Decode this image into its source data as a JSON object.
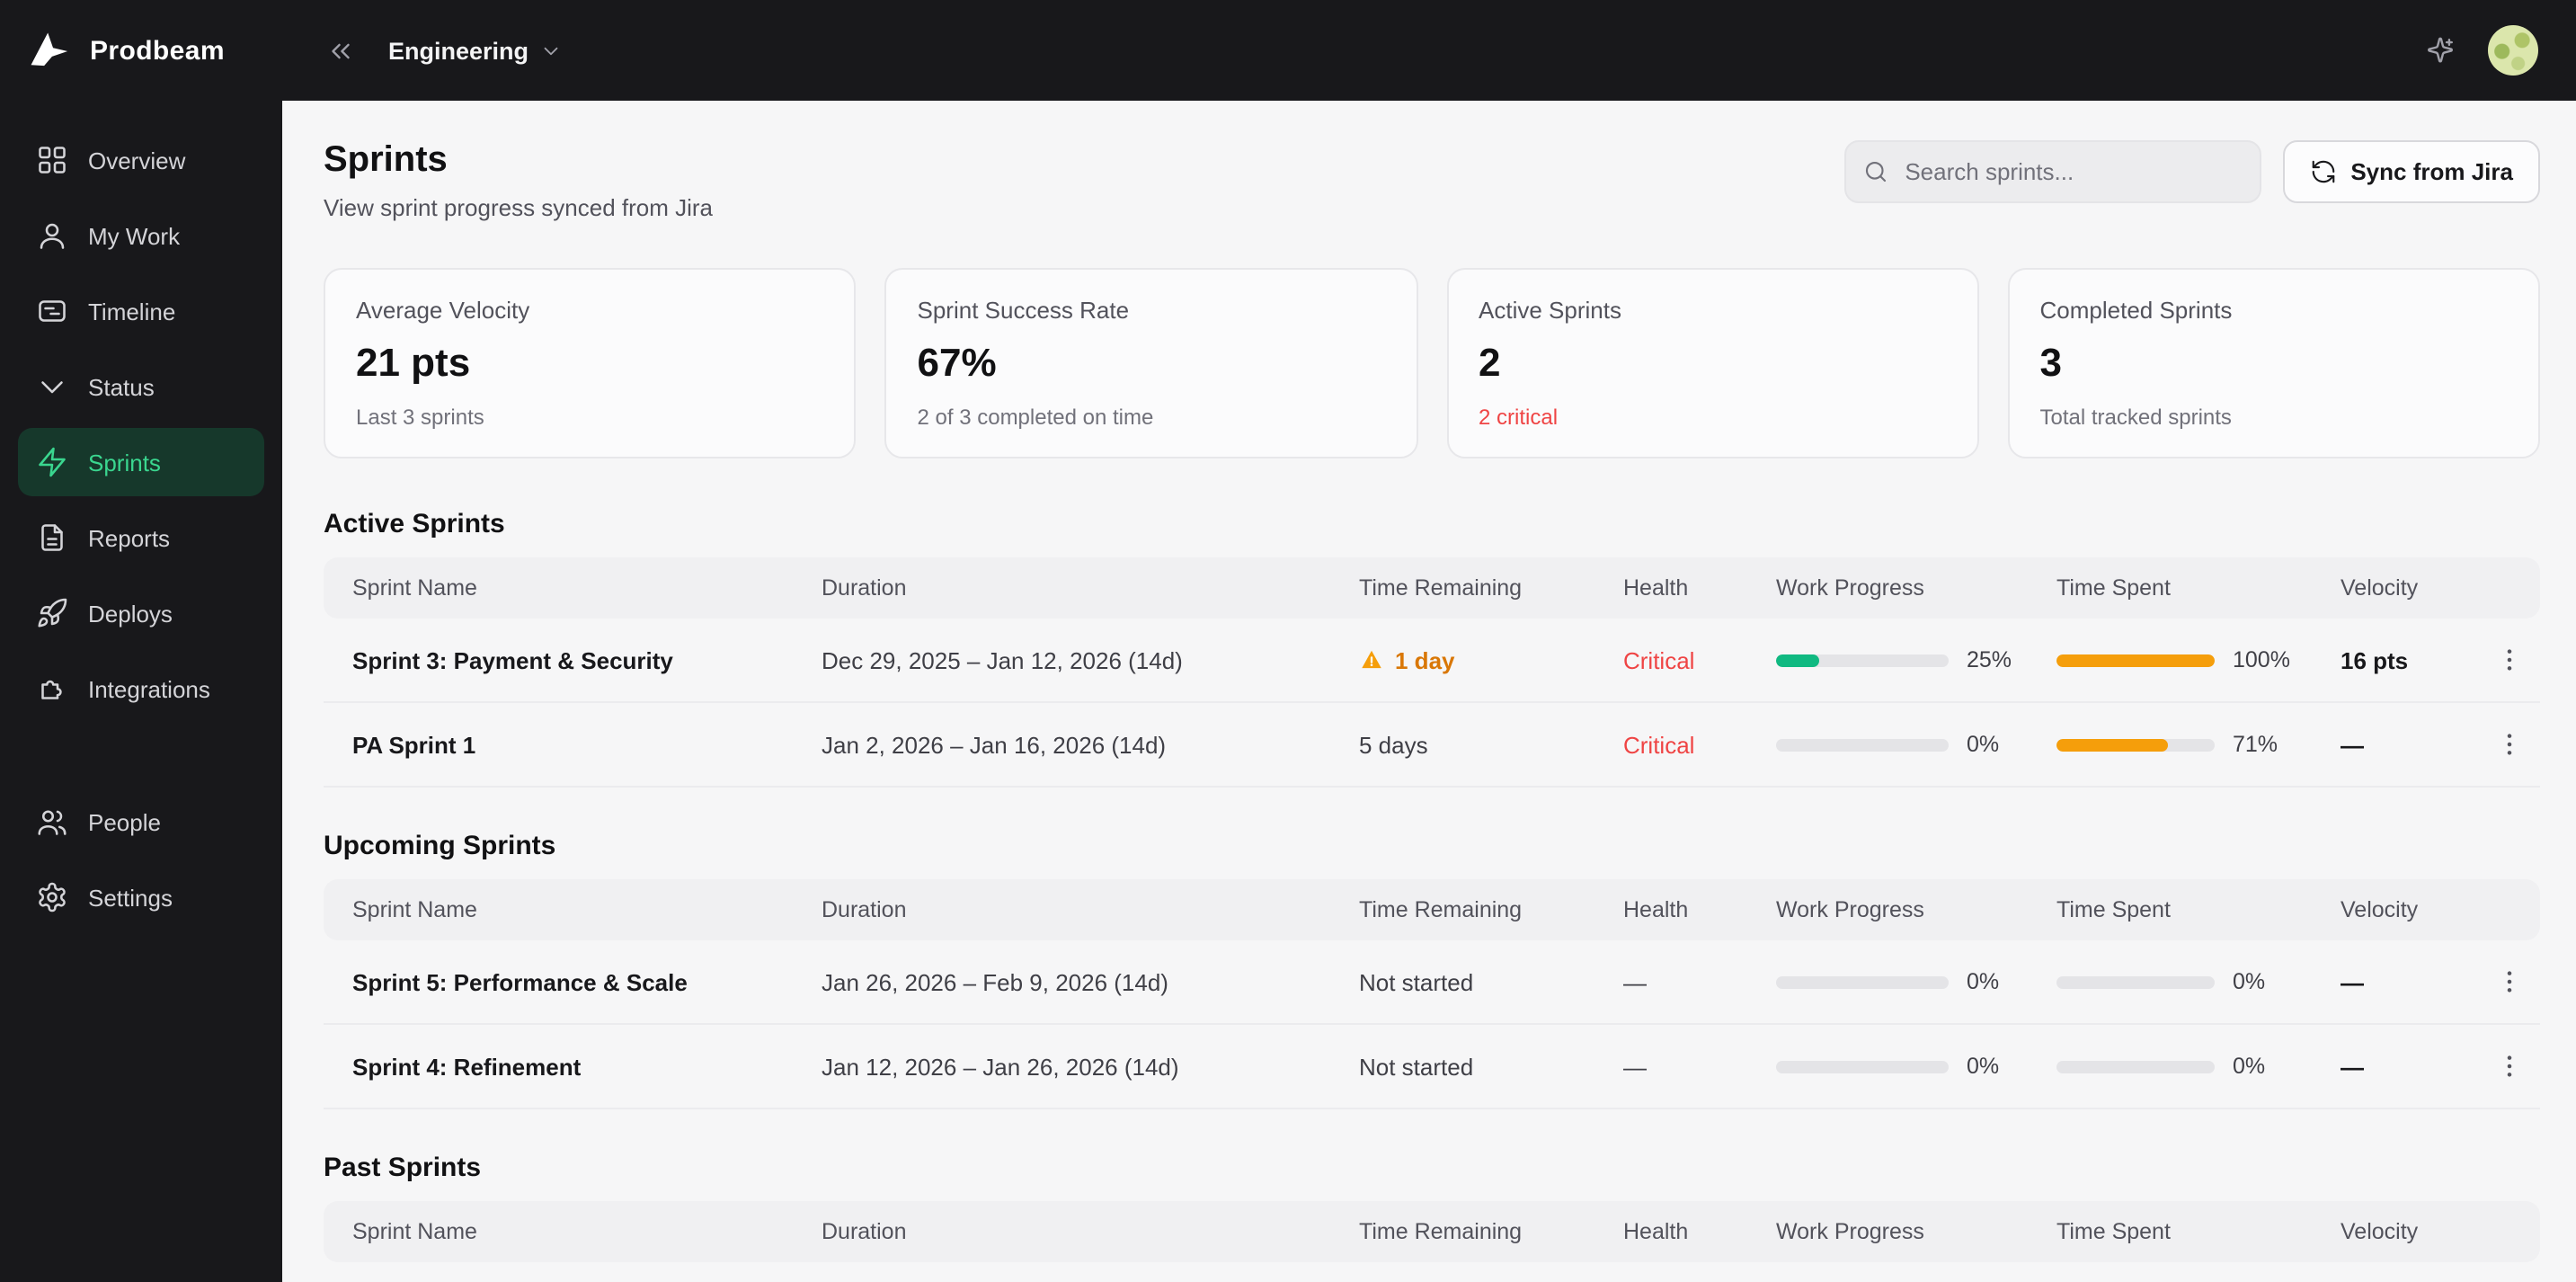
{
  "brand": {
    "name": "Prodbeam"
  },
  "topbar": {
    "workspace": "Engineering"
  },
  "sidebar": {
    "items": [
      {
        "label": "Overview",
        "icon": "grid-icon",
        "active": false
      },
      {
        "label": "My Work",
        "icon": "user-icon",
        "active": false
      },
      {
        "label": "Timeline",
        "icon": "timeline-icon",
        "active": false
      },
      {
        "label": "Status",
        "icon": "chevron-down-icon",
        "active": false
      },
      {
        "label": "Sprints",
        "icon": "zap-icon",
        "active": true
      },
      {
        "label": "Reports",
        "icon": "document-icon",
        "active": false
      },
      {
        "label": "Deploys",
        "icon": "rocket-icon",
        "active": false
      },
      {
        "label": "Integrations",
        "icon": "puzzle-icon",
        "active": false
      },
      {
        "label": "People",
        "icon": "people-icon",
        "active": false,
        "group": "bottom"
      },
      {
        "label": "Settings",
        "icon": "gear-icon",
        "active": false,
        "group": "bottom"
      }
    ]
  },
  "page": {
    "title": "Sprints",
    "subtitle": "View sprint progress synced from Jira",
    "search_placeholder": "Search sprints...",
    "sync_label": "Sync from Jira"
  },
  "stats": [
    {
      "label": "Average Velocity",
      "value": "21 pts",
      "sub": "Last 3 sprints",
      "sub_variant": "muted"
    },
    {
      "label": "Sprint Success Rate",
      "value": "67%",
      "sub": "2 of 3 completed on time",
      "sub_variant": "muted"
    },
    {
      "label": "Active Sprints",
      "value": "2",
      "sub": "2 critical",
      "sub_variant": "danger"
    },
    {
      "label": "Completed Sprints",
      "value": "3",
      "sub": "Total tracked sprints",
      "sub_variant": "muted"
    }
  ],
  "table_columns": [
    "Sprint Name",
    "Duration",
    "Time Remaining",
    "Health",
    "Work Progress",
    "Time Spent",
    "Velocity"
  ],
  "sections": [
    {
      "title": "Active Sprints",
      "rows": [
        {
          "name": "Sprint 3: Payment & Security",
          "duration": "Dec 29, 2025 – Jan 12, 2026 (14d)",
          "time_remaining": "1 day",
          "time_warning": true,
          "health": "Critical",
          "health_variant": "critical",
          "work_pct": 25,
          "work_label": "25%",
          "work_color": "#10b981",
          "spent_pct": 100,
          "spent_label": "100%",
          "spent_color": "#f59e0b",
          "velocity": "16 pts"
        },
        {
          "name": "PA Sprint 1",
          "duration": "Jan 2, 2026 – Jan 16, 2026 (14d)",
          "time_remaining": "5 days",
          "time_warning": false,
          "health": "Critical",
          "health_variant": "critical",
          "work_pct": 0,
          "work_label": "0%",
          "work_color": "#10b981",
          "spent_pct": 71,
          "spent_label": "71%",
          "spent_color": "#f59e0b",
          "velocity": "—"
        }
      ]
    },
    {
      "title": "Upcoming Sprints",
      "rows": [
        {
          "name": "Sprint 5: Performance & Scale",
          "duration": "Jan 26, 2026 – Feb 9, 2026 (14d)",
          "time_remaining": "Not started",
          "time_warning": false,
          "health": "—",
          "health_variant": "none",
          "work_pct": 0,
          "work_label": "0%",
          "work_color": "#10b981",
          "spent_pct": 0,
          "spent_label": "0%",
          "spent_color": "#f59e0b",
          "velocity": "—"
        },
        {
          "name": "Sprint 4: Refinement",
          "duration": "Jan 12, 2026 – Jan 26, 2026 (14d)",
          "time_remaining": "Not started",
          "time_warning": false,
          "health": "—",
          "health_variant": "none",
          "work_pct": 0,
          "work_label": "0%",
          "work_color": "#10b981",
          "spent_pct": 0,
          "spent_label": "0%",
          "spent_color": "#f59e0b",
          "velocity": "—"
        }
      ]
    },
    {
      "title": "Past Sprints",
      "rows": []
    }
  ],
  "colors": {
    "accent_green": "#10b981",
    "amber": "#f59e0b",
    "danger": "#ef4444",
    "sidebar_active": "#3ad68f"
  }
}
